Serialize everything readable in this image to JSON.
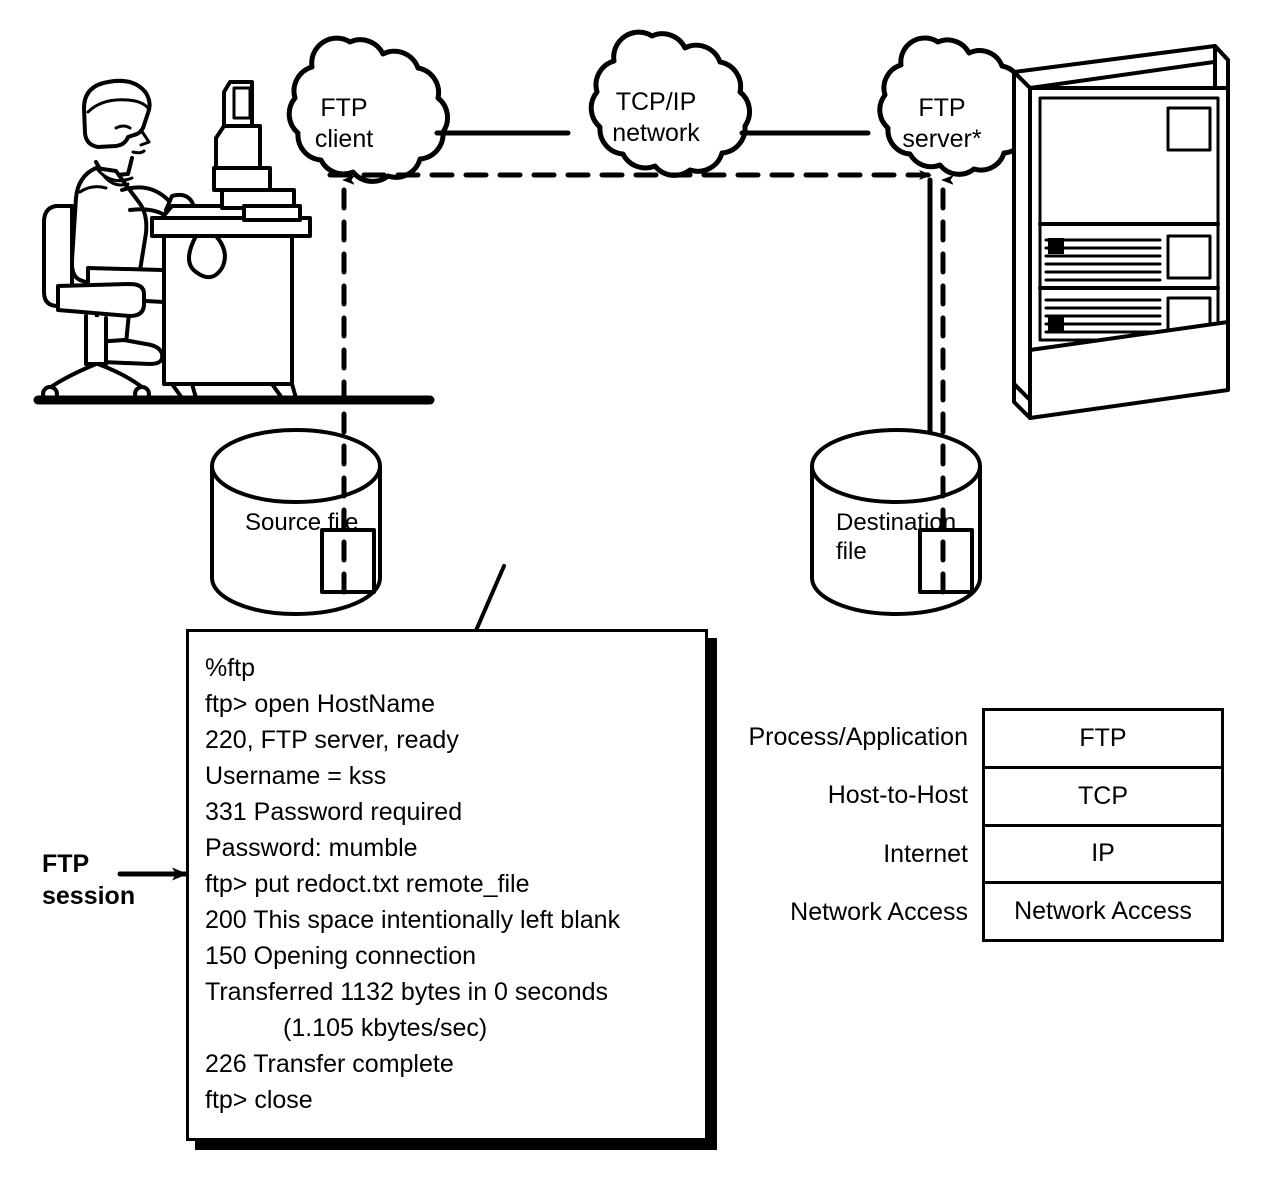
{
  "diagram": {
    "title": "FTP file transfer over a TCP/IP network",
    "line_color": "#000000",
    "background_color": "#ffffff"
  },
  "nodes": {
    "clouds": [
      {
        "id": "ftp-client",
        "label": "FTP\nclient",
        "icon": "cloud-icon"
      },
      {
        "id": "tcpip-network",
        "label": "TCP/IP\nnetwork",
        "icon": "cloud-icon"
      },
      {
        "id": "ftp-server",
        "label": "FTP\nserver*",
        "icon": "cloud-icon"
      }
    ],
    "workstation": {
      "icon": "seated-user-at-terminal-icon",
      "description": "Person seated at a desk with a terminal"
    },
    "mainframe": {
      "icon": "mainframe-computer-icon",
      "description": "Mainframe cabinet with ventilation grilles"
    },
    "stores": [
      {
        "id": "source-file",
        "label": "Source file",
        "icon": "cylinder-icon",
        "file_icon": "file-rectangle-icon"
      },
      {
        "id": "destination-file",
        "label": "Destination\nfile",
        "icon": "cylinder-icon",
        "file_icon": "file-rectangle-icon"
      }
    ]
  },
  "annotations": {
    "ftp_session_caption": "FTP\nsession",
    "session_pointer_icon": "diagonal-arrow-icon",
    "data_path_icon": "dashed-arrow-icon",
    "control_path_icon": "solid-line-icon"
  },
  "session": {
    "title": "FTP session transcript",
    "lines": [
      {
        "text": "%ftp",
        "indented": false
      },
      {
        "text": "ftp> open HostName",
        "indented": false
      },
      {
        "text": "220, FTP server, ready",
        "indented": false
      },
      {
        "text": "Username = kss",
        "indented": false
      },
      {
        "text": "331 Password required",
        "indented": false
      },
      {
        "text": "Password: mumble",
        "indented": false
      },
      {
        "text": "ftp> put redoct.txt remote_file",
        "indented": false
      },
      {
        "text": "200 This space intentionally left blank",
        "indented": false
      },
      {
        "text": "150 Opening connection",
        "indented": false
      },
      {
        "text": "Transferred 1132 bytes in 0 seconds",
        "indented": false
      },
      {
        "text": "(1.105 kbytes/sec)",
        "indented": true
      },
      {
        "text": "226 Transfer complete",
        "indented": false
      },
      {
        "text": "ftp> close",
        "indented": false
      }
    ]
  },
  "protocol_stack": {
    "rows": [
      {
        "layer": "Process/Application",
        "protocol": "FTP"
      },
      {
        "layer": "Host-to-Host",
        "protocol": "TCP"
      },
      {
        "layer": "Internet",
        "protocol": "IP"
      },
      {
        "layer": "Network Access",
        "protocol": "Network Access"
      }
    ]
  }
}
